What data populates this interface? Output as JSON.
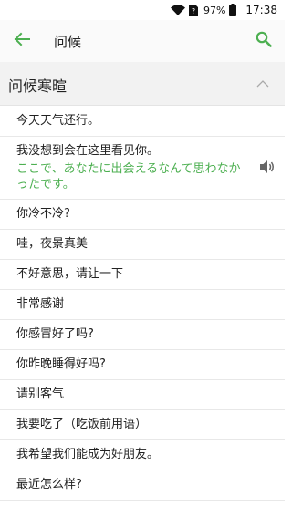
{
  "status_bar": {
    "battery_percent": "97%",
    "time": "17:38"
  },
  "app_bar": {
    "title": "问候"
  },
  "section": {
    "title": "问候寒暄"
  },
  "phrases": [
    {
      "zh": "今天天气还行。"
    },
    {
      "zh": "我没想到会在这里看见你。",
      "ja": "ここで、あなたに出会えるなんて思わなかったです。"
    },
    {
      "zh": "你冷不冷?"
    },
    {
      "zh": "哇，夜景真美"
    },
    {
      "zh": "不好意思，请让一下"
    },
    {
      "zh": "非常感谢"
    },
    {
      "zh": "你感冒好了吗?"
    },
    {
      "zh": "你昨晚睡得好吗?"
    },
    {
      "zh": "请别客气"
    },
    {
      "zh": "我要吃了（吃饭前用语）"
    },
    {
      "zh": "我希望我们能成为好朋友。"
    },
    {
      "zh": "最近怎么样?"
    }
  ],
  "colors": {
    "accent": "#4caf50",
    "section_bg": "#f2f2f2",
    "app_bar_bg": "#fafafa"
  },
  "icons": {
    "back": "arrow-left-icon",
    "search": "search-icon",
    "collapse": "chevron-up-icon",
    "speaker": "speaker-icon",
    "wifi": "wifi-icon",
    "sim": "sim-card-icon",
    "battery": "battery-icon"
  }
}
